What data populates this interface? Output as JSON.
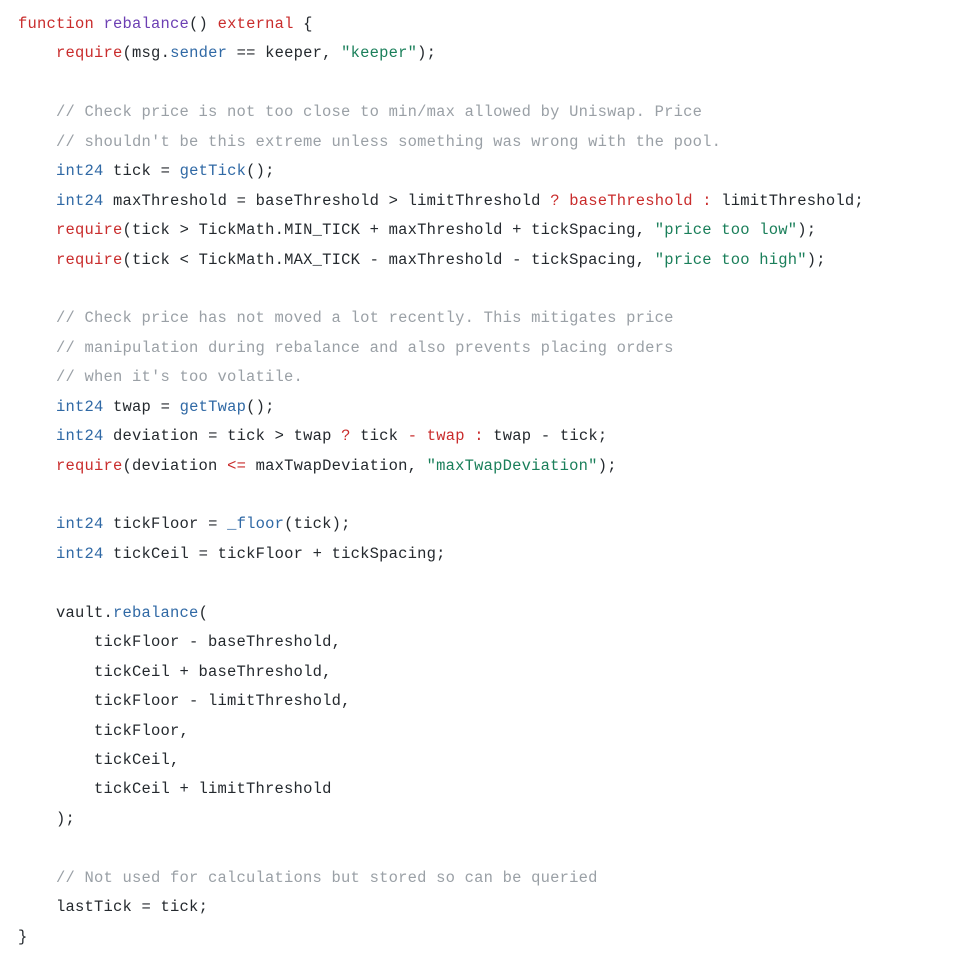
{
  "code": {
    "kw_function": "function",
    "name_rebalance": "rebalance",
    "kw_external": "external",
    "kw_require": "require",
    "prop_sender": "sender",
    "lit_keeper": "\"keeper\"",
    "cmt_price1": "// Check price is not too close to min/max allowed by Uniswap. Price",
    "cmt_price2": "// shouldn't be this extreme unless something was wrong with the pool.",
    "type_int24": "int24",
    "fn_getTick": "getTick",
    "op_q": "?",
    "name_baseThreshold": "baseThreshold",
    "op_colon": ":",
    "lit_low": "\"price too low\"",
    "lit_high": "\"price too high\"",
    "cmt_twap1": "// Check price has not moved a lot recently. This mitigates price",
    "cmt_twap2": "// manipulation during rebalance and also prevents placing orders",
    "cmt_twap3": "// when it's too volatile.",
    "fn_getTwap": "getTwap",
    "op_minus": "-",
    "name_twap": "twap",
    "op_lte": "<=",
    "lit_maxTwap": "\"maxTwapDeviation\"",
    "fn_floor": "_floor",
    "fn_rebalance2": "rebalance",
    "cmt_last": "// Not used for calculations but stored so can be queried",
    "txt_msg": "msg",
    "txt_keeper": "keeper",
    "txt_tick": "tick",
    "txt_maxThreshold": "maxThreshold",
    "txt_baseThreshold": "baseThreshold",
    "txt_limitThreshold": "limitThreshold",
    "txt_TickMathMIN": "TickMath.MIN_TICK",
    "txt_TickMathMAX": "TickMath.MAX_TICK",
    "txt_tickSpacing": "tickSpacing",
    "txt_twap": "twap",
    "txt_deviation": "deviation",
    "txt_maxTwapDeviation": "maxTwapDeviation",
    "txt_tickFloor": "tickFloor",
    "txt_tickCeil": "tickCeil",
    "txt_vault": "vault",
    "txt_lastTick": "lastTick"
  }
}
